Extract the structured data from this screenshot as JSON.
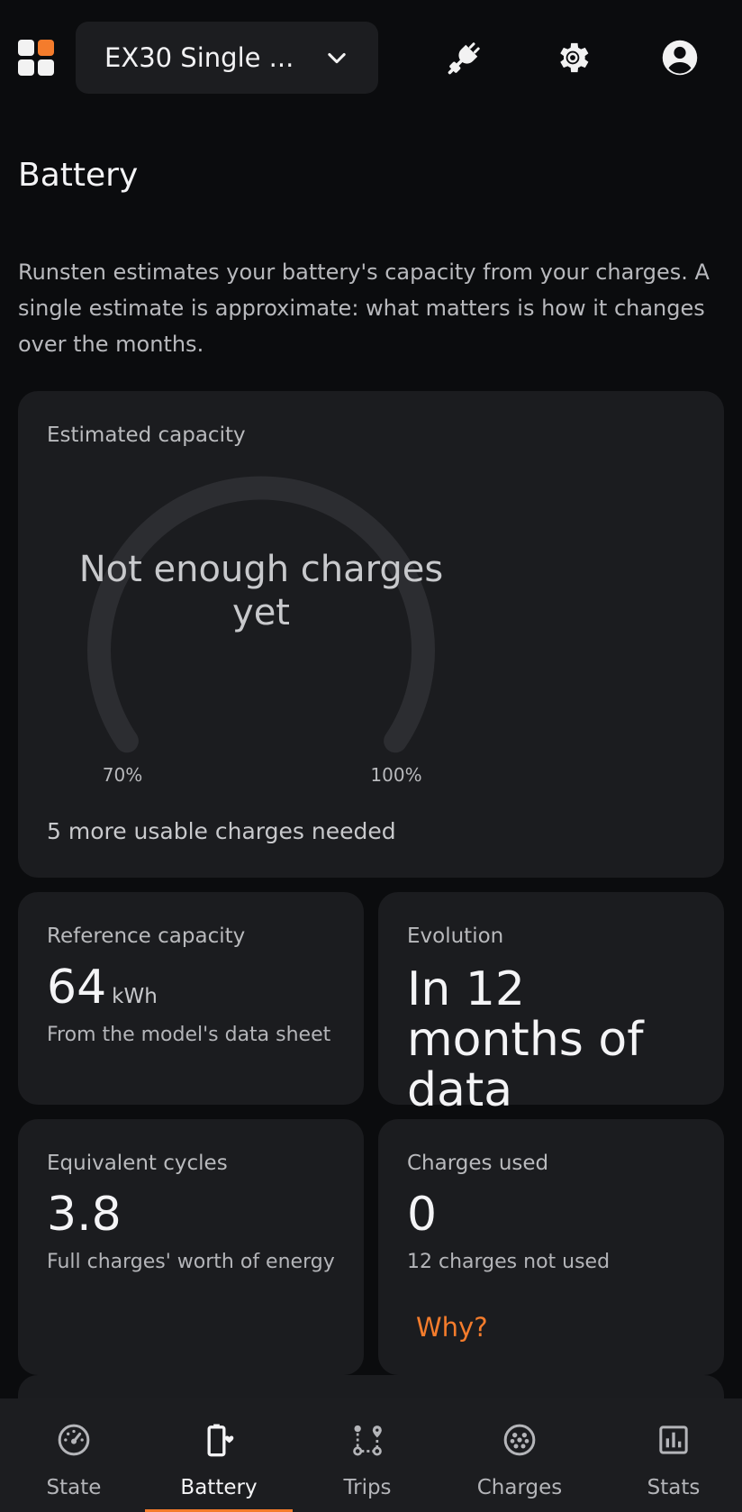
{
  "header": {
    "vehicle_label": "EX30 Single ...",
    "icons": [
      "app-grid-icon",
      "plug-icon",
      "gear-icon",
      "account-icon"
    ]
  },
  "page": {
    "title": "Battery",
    "intro": "Runsten estimates your battery's capacity from your charges. A single estimate is approximate: what matters is how it changes over the months."
  },
  "capacity_card": {
    "title": "Estimated capacity",
    "gauge_message": "Not enough charges yet",
    "gauge_min": "70%",
    "gauge_max": "100%",
    "needed": "5 more usable charges needed"
  },
  "reference_card": {
    "title": "Reference capacity",
    "value": "64",
    "unit": "kWh",
    "note": "From the model's data sheet"
  },
  "evolution_card": {
    "title": "Evolution",
    "value": "In 12 months of data"
  },
  "cycles_card": {
    "title": "Equivalent cycles",
    "value": "3.8",
    "note": "Full charges' worth of energy"
  },
  "charges_card": {
    "title": "Charges used",
    "value": "0",
    "note": "12 charges not used",
    "link": "Why?"
  },
  "nav": {
    "items": [
      {
        "label": "State",
        "icon": "gauge-icon"
      },
      {
        "label": "Battery",
        "icon": "battery-heart-icon"
      },
      {
        "label": "Trips",
        "icon": "route-icon"
      },
      {
        "label": "Charges",
        "icon": "ev-plug-icon"
      },
      {
        "label": "Stats",
        "icon": "bar-chart-icon"
      }
    ],
    "active": "Battery"
  },
  "colors": {
    "background": "#0b0c0e",
    "card": "#1b1c1f",
    "accent": "#f47c2c",
    "gauge_track": "#2c2d31"
  }
}
